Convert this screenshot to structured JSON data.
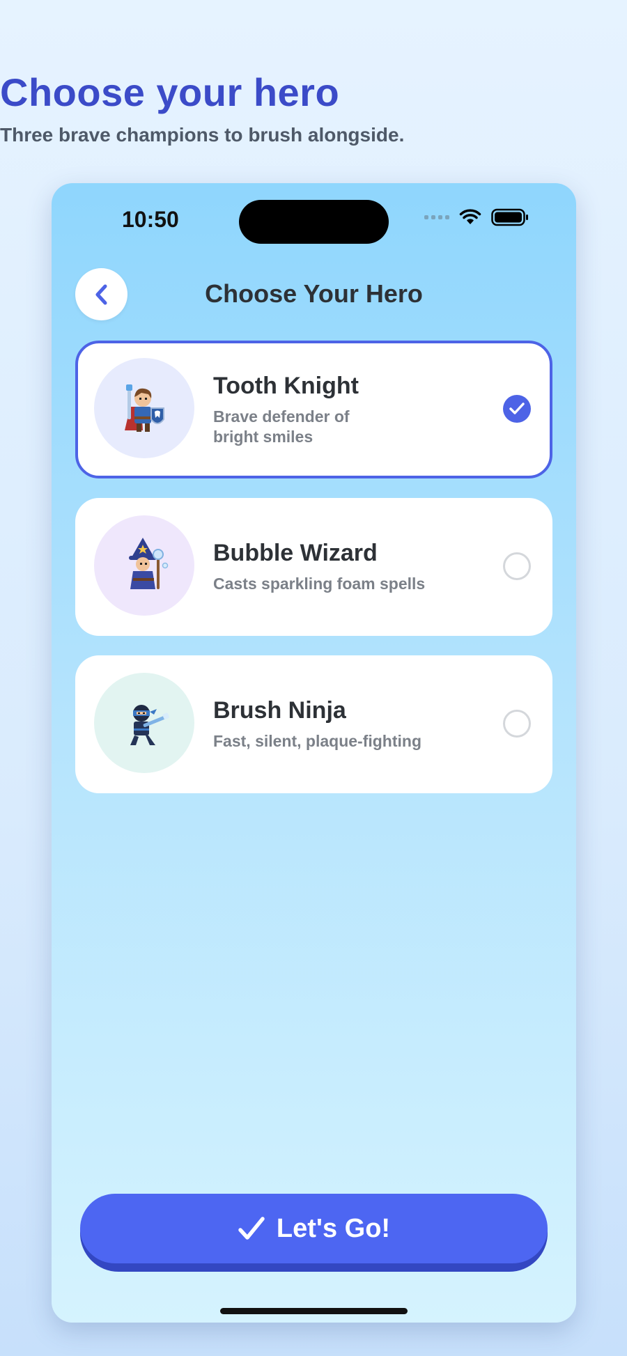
{
  "header": {
    "title": "Choose your hero",
    "subtitle": "Three brave champions to brush alongside."
  },
  "status_bar": {
    "time": "10:50"
  },
  "nav": {
    "title": "Choose Your Hero"
  },
  "heroes": [
    {
      "name": "Tooth Knight",
      "description": "Brave defender of bright smiles",
      "selected": true,
      "avatar_bg": "#e7ebfd",
      "icon": "knight-avatar-icon"
    },
    {
      "name": "Bubble Wizard",
      "description": "Casts sparkling foam spells",
      "selected": false,
      "avatar_bg": "#efe7fc",
      "icon": "wizard-avatar-icon"
    },
    {
      "name": "Brush Ninja",
      "description": "Fast, silent, plaque-fighting",
      "selected": false,
      "avatar_bg": "#e2f4f1",
      "icon": "ninja-avatar-icon"
    }
  ],
  "cta": {
    "label": "Let's Go!"
  },
  "colors": {
    "accent": "#4d63e6",
    "title": "#3b4bc8"
  }
}
